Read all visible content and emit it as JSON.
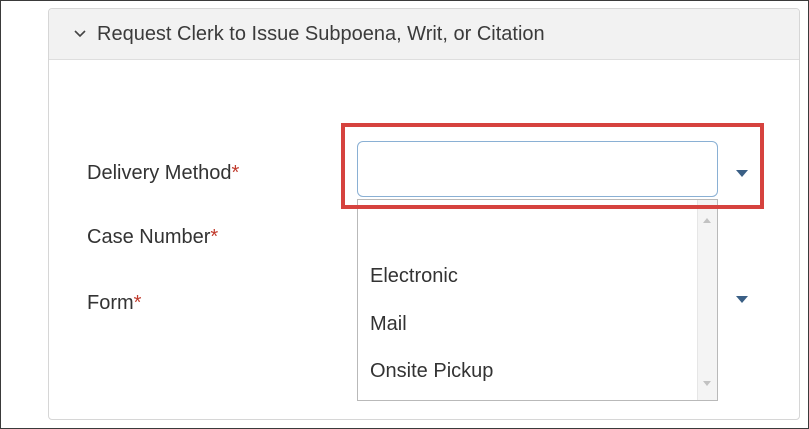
{
  "section": {
    "title": "Request Clerk to Issue Subpoena, Writ, or Citation",
    "expanded_icon": "chevron-down-icon"
  },
  "fields": {
    "delivery_method": {
      "label": "Delivery Method",
      "required_mark": "*",
      "value": ""
    },
    "case_number": {
      "label": "Case Number",
      "required_mark": "*"
    },
    "form": {
      "label": "Form",
      "required_mark": "*"
    }
  },
  "dropdown": {
    "options": [
      "Electronic",
      "Mail",
      "Onsite Pickup"
    ]
  },
  "colors": {
    "highlight": "#d6423e",
    "required": "#c0392b",
    "caret": "#3a5f85"
  }
}
